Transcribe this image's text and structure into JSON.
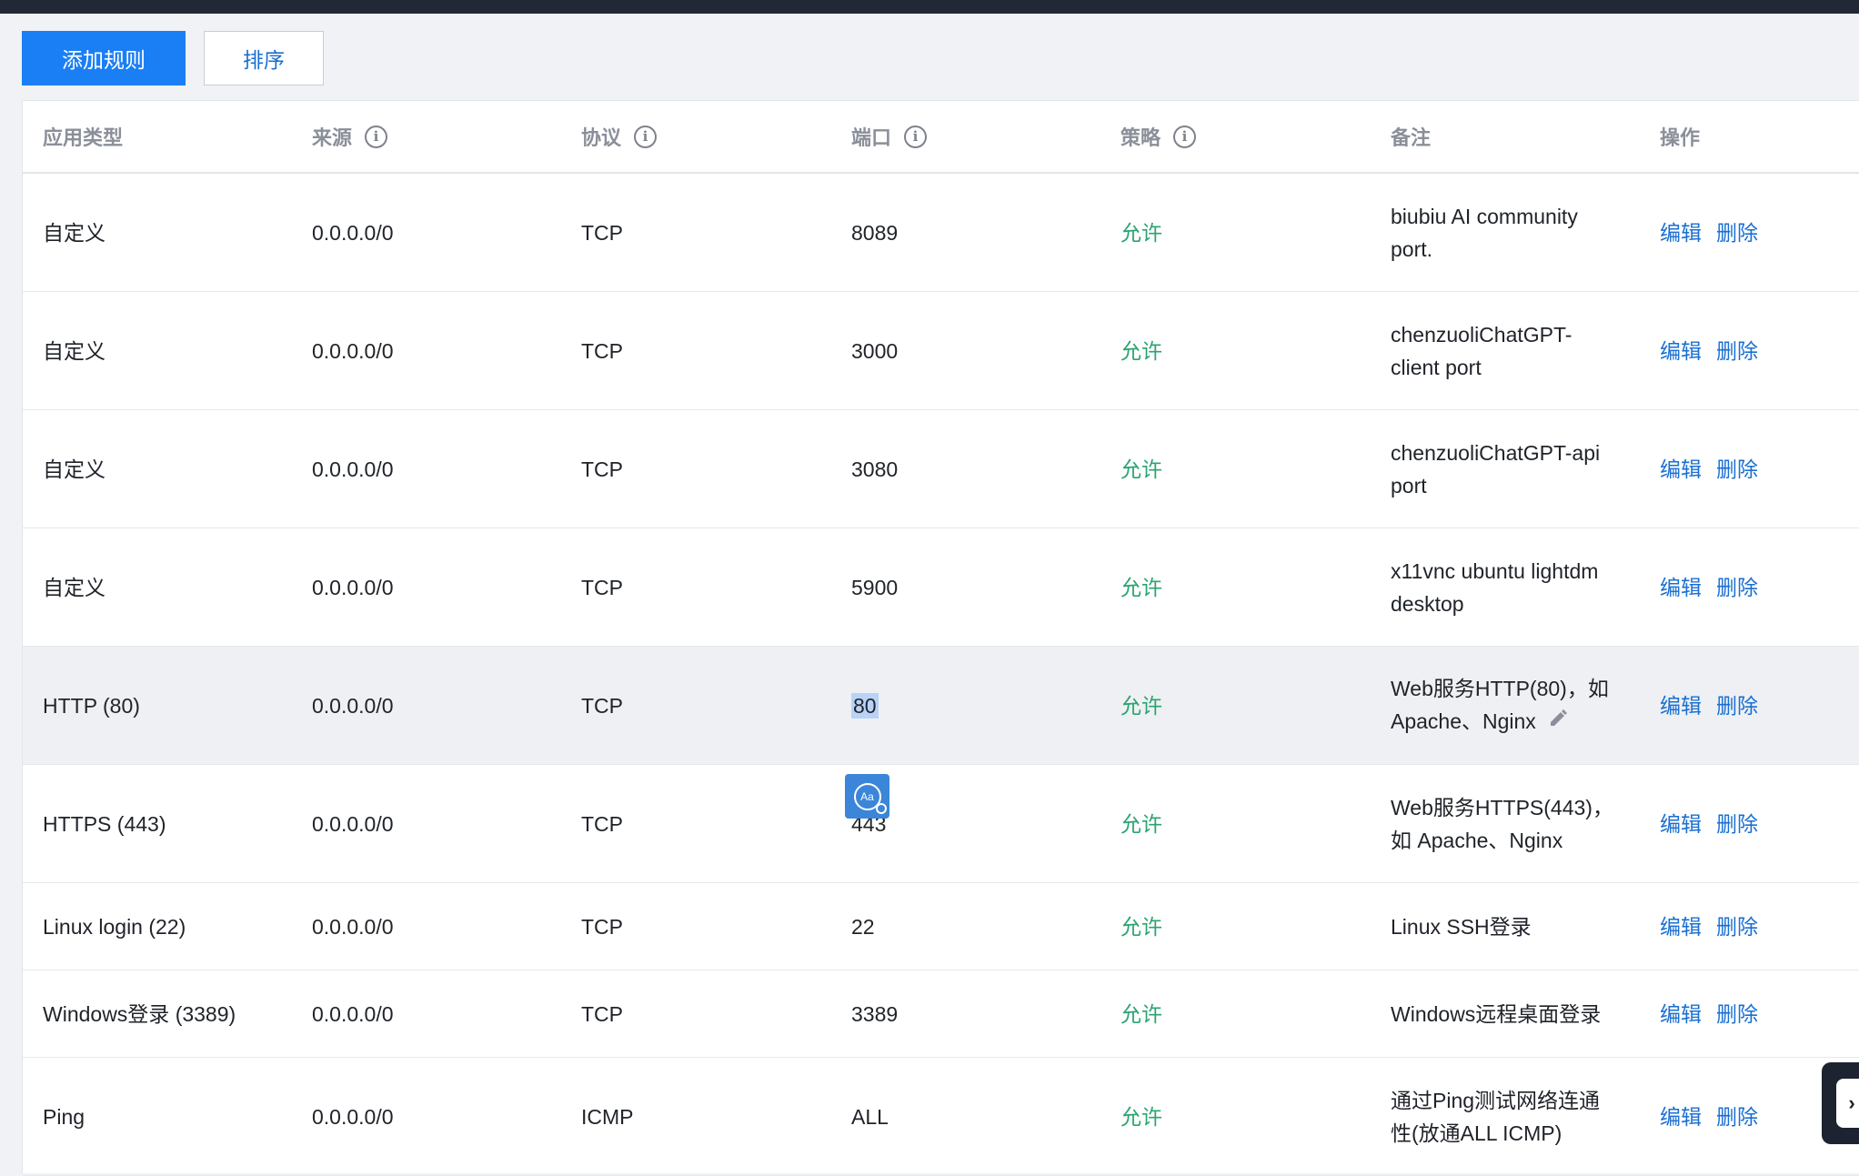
{
  "toolbar": {
    "add_rule": "添加规则",
    "sort": "排序"
  },
  "columns": [
    "应用类型",
    "来源",
    "协议",
    "端口",
    "策略",
    "备注",
    "操作"
  ],
  "actions": {
    "edit": "编辑",
    "delete": "删除"
  },
  "rows": [
    {
      "app": "自定义",
      "source": "0.0.0.0/0",
      "protocol": "TCP",
      "port": "8089",
      "policy": "允许",
      "note": "biubiu AI community port."
    },
    {
      "app": "自定义",
      "source": "0.0.0.0/0",
      "protocol": "TCP",
      "port": "3000",
      "policy": "允许",
      "note": "chenzuoliChatGPT-client port"
    },
    {
      "app": "自定义",
      "source": "0.0.0.0/0",
      "protocol": "TCP",
      "port": "3080",
      "policy": "允许",
      "note": "chenzuoliChatGPT-api port"
    },
    {
      "app": "自定义",
      "source": "0.0.0.0/0",
      "protocol": "TCP",
      "port": "5900",
      "policy": "允许",
      "note": "x11vnc ubuntu lightdm desktop"
    },
    {
      "app": "HTTP (80)",
      "source": "0.0.0.0/0",
      "protocol": "TCP",
      "port": "80",
      "policy": "允许",
      "note": "Web服务HTTP(80)，如 Apache、Nginx"
    },
    {
      "app": "HTTPS (443)",
      "source": "0.0.0.0/0",
      "protocol": "TCP",
      "port": "443",
      "policy": "允许",
      "note": "Web服务HTTPS(443)，如 Apache、Nginx"
    },
    {
      "app": "Linux login (22)",
      "source": "0.0.0.0/0",
      "protocol": "TCP",
      "port": "22",
      "policy": "允许",
      "note": "Linux SSH登录"
    },
    {
      "app": "Windows登录 (3389)",
      "source": "0.0.0.0/0",
      "protocol": "TCP",
      "port": "3389",
      "policy": "允许",
      "note": "Windows远程桌面登录"
    },
    {
      "app": "Ping",
      "source": "0.0.0.0/0",
      "protocol": "ICMP",
      "port": "ALL",
      "policy": "允许",
      "note": "通过Ping测试网络连通性(放通ALL ICMP)"
    }
  ],
  "float_tool": {
    "label": "Aa"
  },
  "colors": {
    "primary": "#1a7ff5",
    "link": "#1a6fd1",
    "allow": "#2ba471",
    "topbar": "#222836"
  }
}
